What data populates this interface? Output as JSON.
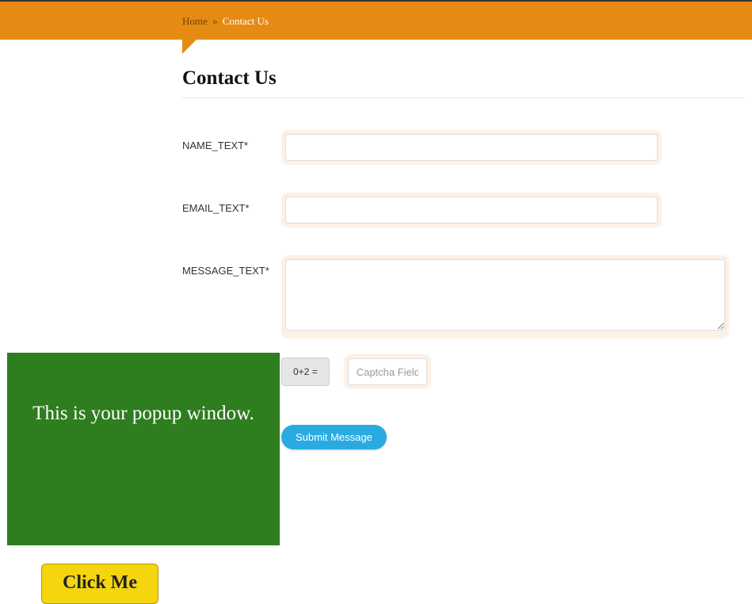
{
  "breadcrumb": {
    "home": "Home",
    "sep": "»",
    "current": "Contact Us"
  },
  "page": {
    "title": "Contact Us"
  },
  "form": {
    "name_label": "NAME_TEXT*",
    "name_value": "",
    "email_label": "EMAIL_TEXT*",
    "email_value": "",
    "message_label": "MESSAGE_TEXT*",
    "message_value": "",
    "captcha_question": "0+2 =",
    "captcha_placeholder": "Captcha Field",
    "captcha_value": "",
    "submit_label": "Submit Message"
  },
  "popup": {
    "text": "This is your popup window."
  },
  "click_me": {
    "label": "Click Me"
  }
}
